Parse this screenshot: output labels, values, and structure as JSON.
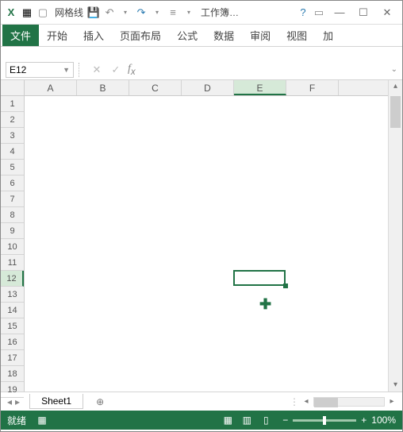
{
  "title": {
    "gridlines": "网格线",
    "workbook": "工作簿…"
  },
  "ribbon": {
    "file": "文件",
    "tabs": [
      "开始",
      "插入",
      "页面布局",
      "公式",
      "数据",
      "审阅",
      "视图",
      "加"
    ]
  },
  "namebox": "E12",
  "columns": [
    "A",
    "B",
    "C",
    "D",
    "E",
    "F"
  ],
  "rows": [
    "1",
    "2",
    "3",
    "4",
    "5",
    "6",
    "7",
    "8",
    "9",
    "10",
    "11",
    "12",
    "13",
    "14",
    "15",
    "16",
    "17",
    "18",
    "19"
  ],
  "active": {
    "col": 4,
    "row": 11
  },
  "sheet": "Sheet1",
  "status": {
    "ready": "就绪",
    "zoom": "100%"
  }
}
